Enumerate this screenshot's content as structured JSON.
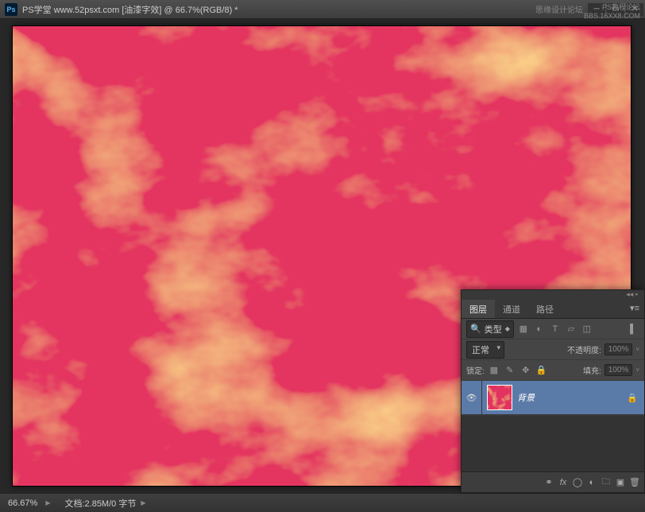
{
  "titlebar": {
    "app_icon": "Ps",
    "title": "PS学堂 www.52psxt.com [油漆字效] @ 66.7%(RGB/8) *",
    "watermark_right": "思缘设计论坛"
  },
  "watermark_corner": {
    "line1": "PS教程论坛",
    "line2": "BBS.16XX8.COM"
  },
  "statusbar": {
    "zoom": "66.67%",
    "docinfo": "文档:2.85M/0 字节"
  },
  "layers_panel": {
    "tabs": {
      "t1": "图层",
      "t2": "通道",
      "t3": "路径"
    },
    "filter_label": "类型",
    "blend_mode": "正常",
    "opacity_label": "不透明度:",
    "opacity_value": "100%",
    "lock_label": "锁定:",
    "fill_label": "填充:",
    "fill_value": "100%",
    "layer_name": "背景"
  },
  "icons": {
    "search": "search-icon",
    "image": "image-icon",
    "adjust": "adjust-icon",
    "type": "T",
    "shape": "shape-icon",
    "smart": "smart-icon",
    "toggle": "toggle-icon",
    "lock_all": "lock-icon",
    "lock_pix": "brush-icon",
    "lock_pos": "move-icon",
    "lock_trans": "grid-icon",
    "eye": "eye-icon",
    "layerlock": "lock-icon",
    "link": "link-icon",
    "fx": "fx",
    "mask": "mask-icon",
    "fill": "fill-icon",
    "group": "folder-icon",
    "new": "new-icon",
    "trash": "trash-icon"
  }
}
